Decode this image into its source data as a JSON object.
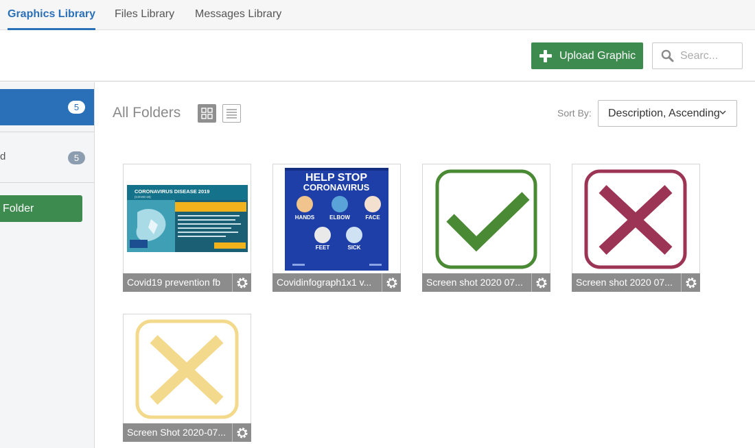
{
  "tabs": [
    {
      "label": "Graphics Library",
      "active": true
    },
    {
      "label": "Files Library",
      "active": false
    },
    {
      "label": "Messages Library",
      "active": false
    }
  ],
  "toolbar": {
    "upload_label": "Upload Graphic",
    "search_placeholder": "Searc..."
  },
  "sidebar": {
    "items": [
      {
        "label": "",
        "count": "5",
        "selected": true
      },
      {
        "label": "d",
        "count": "5",
        "selected": false
      }
    ],
    "new_folder_label": "Folder"
  },
  "main": {
    "title": "All Folders",
    "sort_label": "Sort By:",
    "sort_value": "Description, Ascending"
  },
  "graphics": [
    {
      "name": "Covid19 prevention fb",
      "thumb_title": "CORONAVIRUS DISEASE 2019",
      "thumb_sub": "(COVID-19)"
    },
    {
      "name": "Covidinfograph1x1 v...",
      "thumb_title_1": "HELP STOP",
      "thumb_title_2": "CORONAVIRUS",
      "items": [
        "HANDS",
        "ELBOW",
        "FACE",
        "FEET",
        "SICK"
      ]
    },
    {
      "name": "Screen shot 2020 07...",
      "icon": "check",
      "color": "#4b8a35"
    },
    {
      "name": "Screen shot 2020 07...",
      "icon": "x",
      "color": "#9c3456"
    },
    {
      "name": "Screen Shot 2020-07...",
      "icon": "x",
      "color": "#f3d98c"
    }
  ],
  "colors": {
    "accent": "#2a70b8",
    "primary_button": "#3d8b4f"
  }
}
